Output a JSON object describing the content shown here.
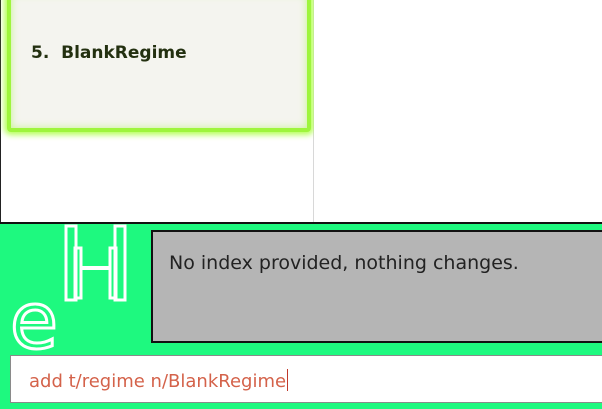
{
  "regime_list": {
    "items": [
      {
        "index_label": "5.",
        "name": "BlankRegime"
      }
    ]
  },
  "result_display": {
    "text": "No index provided, nothing changes."
  },
  "command_box": {
    "value": "add t/regime n/BlankRegime"
  },
  "logo": {
    "icon": "dumbbell-e-logo",
    "colors": {
      "stroke": "#ffffff",
      "background": "#1ef97f"
    }
  },
  "colors": {
    "card_border": "#9ef53c",
    "bar_background": "#1ef97f",
    "result_background": "#b5b5b5",
    "command_text": "#d4624a"
  }
}
